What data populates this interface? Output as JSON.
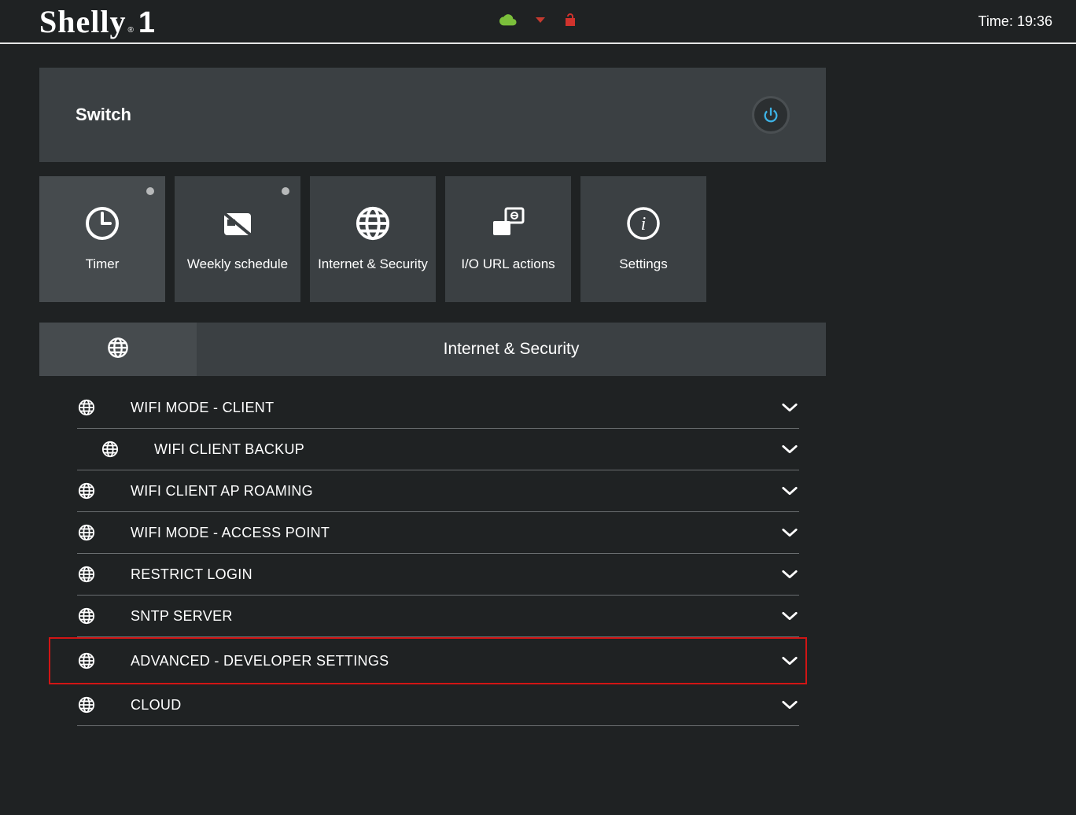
{
  "header": {
    "logo_text": "Shelly",
    "logo_model": "1",
    "time_label": "Time: 19:36"
  },
  "switch_card": {
    "title": "Switch"
  },
  "tiles": [
    {
      "id": "timer",
      "label": "Timer",
      "has_dot": true,
      "active": true
    },
    {
      "id": "weekly",
      "label": "Weekly schedule",
      "has_dot": true,
      "active": false
    },
    {
      "id": "internet",
      "label": "Internet & Security",
      "has_dot": false,
      "active": false
    },
    {
      "id": "io",
      "label": "I/O URL actions",
      "has_dot": false,
      "active": false
    },
    {
      "id": "settings",
      "label": "Settings",
      "has_dot": false,
      "active": false
    }
  ],
  "section": {
    "title": "Internet & Security",
    "items": [
      {
        "label": "WIFI MODE - CLIENT",
        "indent": false,
        "highlighted": false
      },
      {
        "label": "WIFI CLIENT BACKUP",
        "indent": true,
        "highlighted": false
      },
      {
        "label": "WIFI CLIENT AP ROAMING",
        "indent": false,
        "highlighted": false
      },
      {
        "label": "WIFI MODE - ACCESS POINT",
        "indent": false,
        "highlighted": false
      },
      {
        "label": "RESTRICT LOGIN",
        "indent": false,
        "highlighted": false
      },
      {
        "label": "SNTP SERVER",
        "indent": false,
        "highlighted": false
      },
      {
        "label": "ADVANCED - DEVELOPER SETTINGS",
        "indent": false,
        "highlighted": true
      },
      {
        "label": "CLOUD",
        "indent": false,
        "highlighted": false
      }
    ]
  },
  "colors": {
    "cloud": "#7bbf3b",
    "alert": "#c43a2f",
    "lock": "#d0332d",
    "power": "#3db3e6"
  }
}
